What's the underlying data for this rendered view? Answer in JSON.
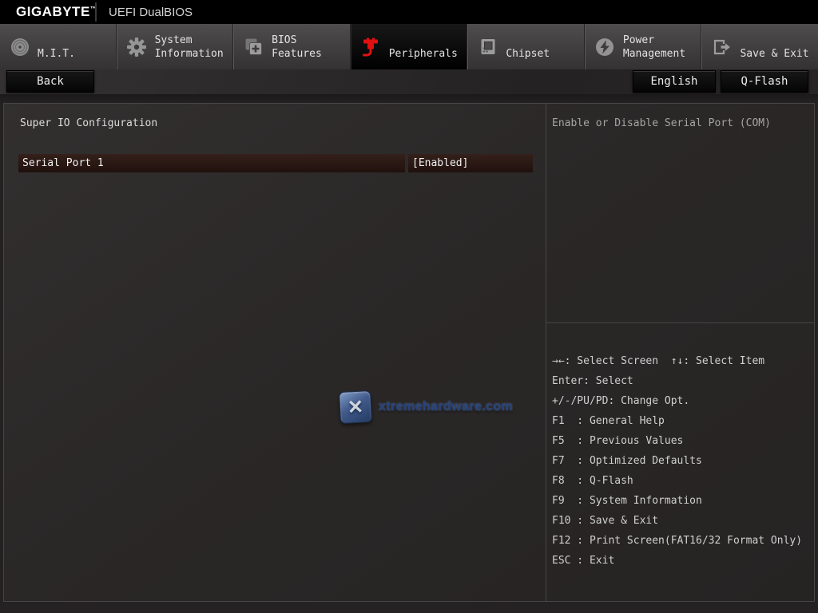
{
  "header": {
    "brand": "GIGABYTE",
    "trademark": "™",
    "title": "UEFI DualBIOS"
  },
  "tabs": [
    {
      "label": "M.I.T.",
      "icon": "dial-icon",
      "active": false
    },
    {
      "label": "System\nInformation",
      "icon": "gear-icon",
      "active": false
    },
    {
      "label": "BIOS\nFeatures",
      "icon": "bios-features-icon",
      "active": false
    },
    {
      "label": "Peripherals",
      "icon": "peripherals-icon",
      "active": true
    },
    {
      "label": "Chipset",
      "icon": "chipset-icon",
      "active": false
    },
    {
      "label": "Power\nManagement",
      "icon": "power-icon",
      "active": false
    },
    {
      "label": "Save & Exit",
      "icon": "save-exit-icon",
      "active": false
    }
  ],
  "toolbar": {
    "back_label": "Back",
    "language_label": "English",
    "qflash_label": "Q-Flash"
  },
  "main": {
    "section_title": "Super IO Configuration",
    "settings": [
      {
        "label": "Serial Port 1",
        "value": "[Enabled]"
      }
    ]
  },
  "help": {
    "description": "Enable or Disable Serial Port (COM)",
    "keys": [
      "→←: Select Screen  ↑↓: Select Item",
      "Enter: Select",
      "+/-/PU/PD: Change Opt.",
      "F1  : General Help",
      "F5  : Previous Values",
      "F7  : Optimized Defaults",
      "F8  : Q-Flash",
      "F9  : System Information",
      "F10 : Save & Exit",
      "F12 : Print Screen(FAT16/32 Format Only)",
      "ESC : Exit"
    ]
  },
  "watermark": {
    "text": "xtremehardware.com",
    "x_glyph": "✕"
  },
  "colors": {
    "accent_red": "#e01010",
    "highlight_row": "#2a1a14",
    "panel_border": "#474545"
  }
}
